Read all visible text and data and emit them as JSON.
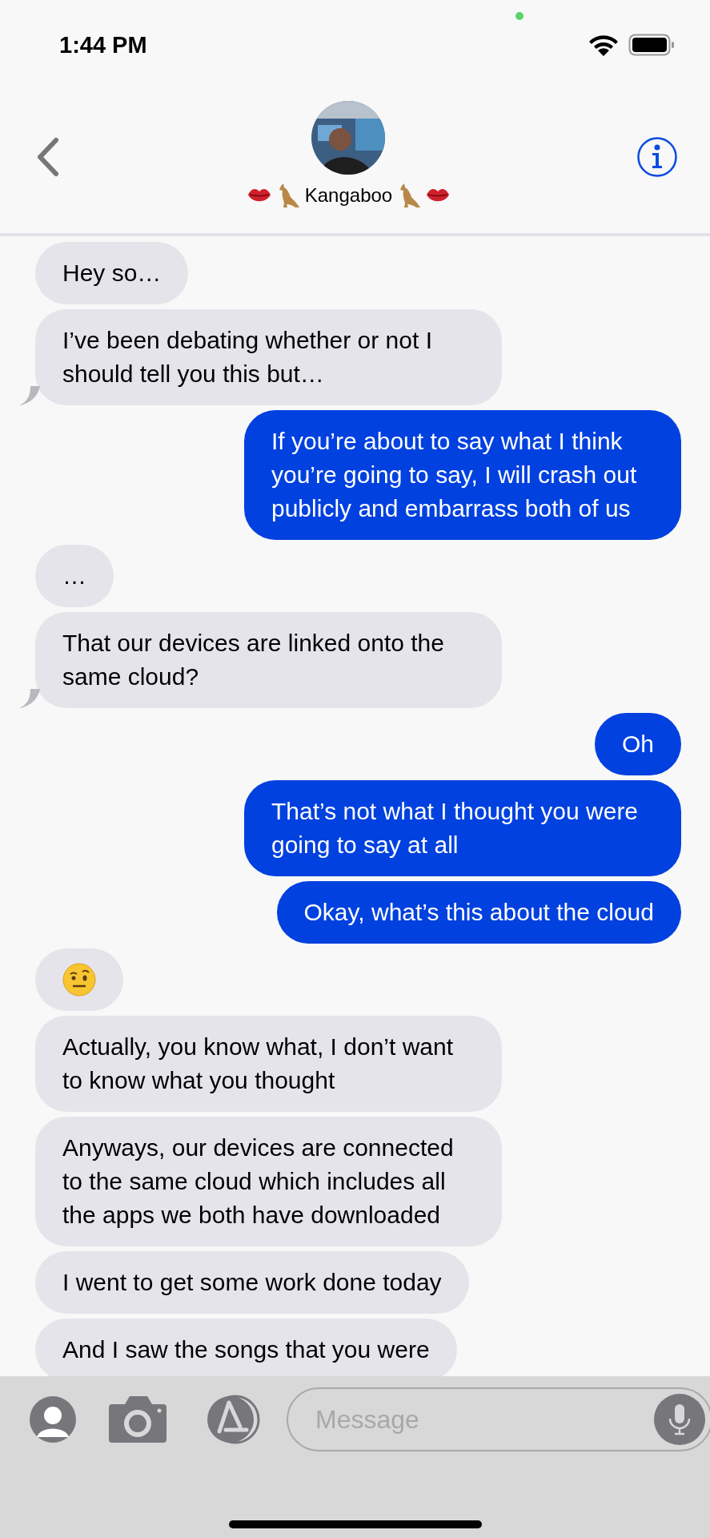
{
  "status_bar": {
    "time": "1:44 PM"
  },
  "header": {
    "contact_name": "Kangaboo"
  },
  "messages": [
    {
      "kind": "received_text",
      "text": "Hey so…",
      "tail": false
    },
    {
      "kind": "received_text",
      "text": "I’ve been debating whether or not I should tell you this but…",
      "tail": true
    },
    {
      "kind": "sent_text",
      "text": "If you’re about to say what I think you’re going to say, I will crash out publicly and embarrass both of us",
      "tail": false
    },
    {
      "kind": "received_text",
      "text": "…",
      "tail": false
    },
    {
      "kind": "received_text",
      "text": "That our devices are linked onto the same cloud?",
      "tail": true
    },
    {
      "kind": "sent_text",
      "text": "Oh",
      "tail": false
    },
    {
      "kind": "sent_text",
      "text": "That’s not what I thought you were going to say at all",
      "tail": false
    },
    {
      "kind": "sent_text",
      "text": "Okay, what’s this about the cloud",
      "tail": false
    },
    {
      "kind": "received_emoji",
      "tail": false
    },
    {
      "kind": "received_text",
      "text": "Actually, you know what, I don’t want to know what you thought",
      "tail": false
    },
    {
      "kind": "received_text",
      "text": "Anyways, our devices are connected to the same cloud which includes all the apps we both have downloaded",
      "tail": false
    },
    {
      "kind": "received_text",
      "text": "I went to get some work done today",
      "tail": false
    },
    {
      "kind": "received_text",
      "text": "And I saw the songs that you were",
      "tail": false
    }
  ],
  "composer": {
    "placeholder": "Message"
  }
}
